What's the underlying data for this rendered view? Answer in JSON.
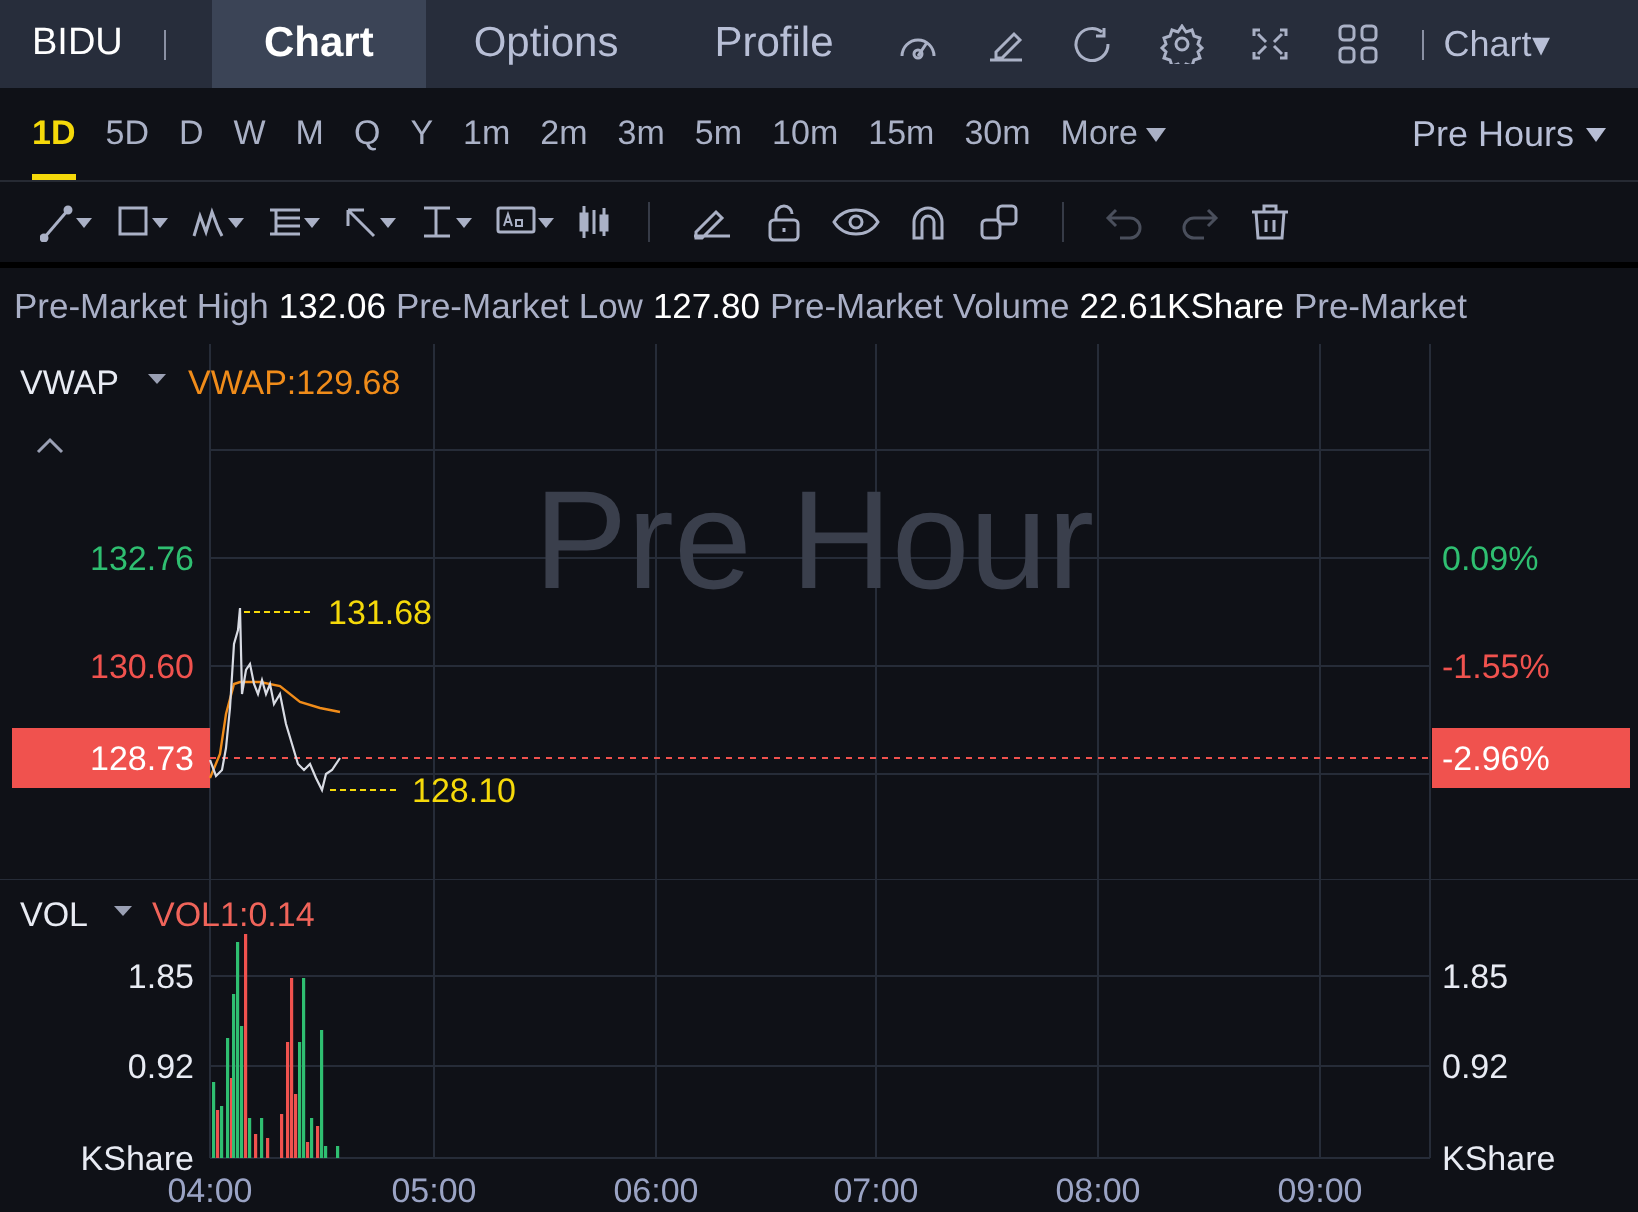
{
  "header": {
    "symbol": "BIDU",
    "tabs": [
      {
        "label": "Chart",
        "selected": true
      },
      {
        "label": "Options",
        "selected": false
      },
      {
        "label": "Profile",
        "selected": false
      }
    ],
    "chart_menu": "Chart▾"
  },
  "periods": [
    {
      "label": "1D",
      "selected": true
    },
    {
      "label": "5D",
      "selected": false
    },
    {
      "label": "D",
      "selected": false
    },
    {
      "label": "W",
      "selected": false
    },
    {
      "label": "M",
      "selected": false
    },
    {
      "label": "Q",
      "selected": false
    },
    {
      "label": "Y",
      "selected": false
    },
    {
      "label": "1m",
      "selected": false
    },
    {
      "label": "2m",
      "selected": false
    },
    {
      "label": "3m",
      "selected": false
    },
    {
      "label": "5m",
      "selected": false
    },
    {
      "label": "10m",
      "selected": false
    },
    {
      "label": "15m",
      "selected": false
    },
    {
      "label": "30m",
      "selected": false
    }
  ],
  "more": "More",
  "session": "Pre Hours",
  "tools": {
    "undo_disabled": true,
    "redo_disabled": true
  },
  "stats": [
    {
      "label": "Pre-Market High",
      "value": "132.06"
    },
    {
      "label": "Pre-Market Low",
      "value": "127.80"
    },
    {
      "label": "Pre-Market Volume",
      "value": "22.61KShare"
    },
    {
      "label": "Pre-Market"
    }
  ],
  "price_pane": {
    "indicator": "VWAP",
    "indicator_value": "VWAP:129.68",
    "watermark": "Pre Hour",
    "left_axis": [
      {
        "label": "132.76",
        "kind": "up"
      },
      {
        "label": "130.60",
        "kind": "down"
      }
    ],
    "right_axis": [
      {
        "label": "0.09%",
        "kind": "up"
      },
      {
        "label": "-1.55%",
        "kind": "down"
      }
    ],
    "current_price": "128.73",
    "current_change": "-2.96%",
    "high_marker": "131.68",
    "low_marker": "128.10"
  },
  "volume_pane": {
    "indicator": "VOL",
    "indicator_value": "VOL1:0.14",
    "left_axis": [
      "1.85",
      "0.92",
      "KShare"
    ],
    "right_axis": [
      "1.85",
      "0.92",
      "KShare"
    ]
  },
  "time_axis": [
    "04:00",
    "05:00",
    "06:00",
    "07:00",
    "08:00",
    "09:00"
  ]
}
